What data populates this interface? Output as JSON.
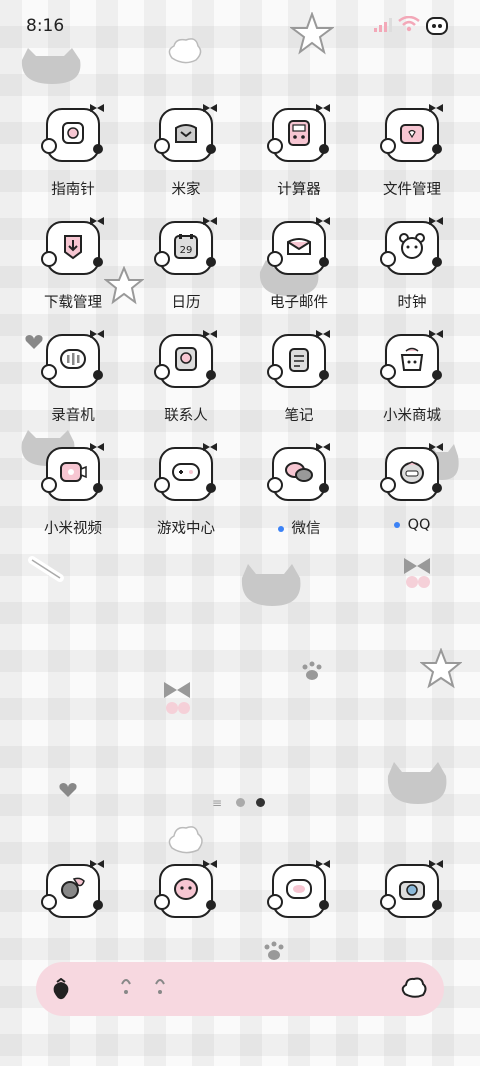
{
  "status": {
    "time": "8:16"
  },
  "apps": [
    {
      "label": "指南针",
      "icon": "compass-icon"
    },
    {
      "label": "米家",
      "icon": "home-device-icon"
    },
    {
      "label": "计算器",
      "icon": "calculator-icon"
    },
    {
      "label": "文件管理",
      "icon": "folder-icon"
    },
    {
      "label": "下载管理",
      "icon": "download-icon"
    },
    {
      "label": "日历",
      "icon": "calendar-icon"
    },
    {
      "label": "电子邮件",
      "icon": "email-icon"
    },
    {
      "label": "时钟",
      "icon": "clock-icon"
    },
    {
      "label": "录音机",
      "icon": "recorder-icon"
    },
    {
      "label": "联系人",
      "icon": "contacts-icon"
    },
    {
      "label": "笔记",
      "icon": "notes-icon"
    },
    {
      "label": "小米商城",
      "icon": "store-icon"
    },
    {
      "label": "小米视频",
      "icon": "video-icon"
    },
    {
      "label": "游戏中心",
      "icon": "gamepad-icon"
    },
    {
      "label": "微信",
      "icon": "wechat-icon",
      "badge": true
    },
    {
      "label": "QQ",
      "icon": "qq-icon",
      "badge": true
    }
  ],
  "calendar_day": "29",
  "pager": {
    "pages": 2,
    "current": 2
  },
  "dock": [
    {
      "icon": "phone-icon"
    },
    {
      "icon": "messages-icon"
    },
    {
      "icon": "browser-icon"
    },
    {
      "icon": "camera-icon"
    }
  ],
  "colors": {
    "accent_pink": "#f7d8e0",
    "badge_blue": "#3b82f6"
  }
}
